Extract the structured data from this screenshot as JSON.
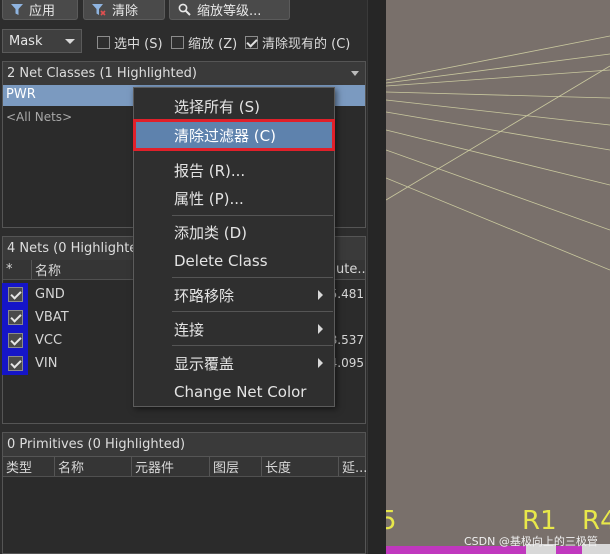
{
  "toolbar": {
    "apply_label": "应用",
    "clear_label": "清除",
    "zoom_level_label": "缩放等级..."
  },
  "filter": {
    "mode_value": "Mask",
    "select_label": "选中 (S)",
    "zoom_label": "缩放 (Z)",
    "clear_existing_label": "清除现有的 (C)",
    "select_checked": false,
    "zoom_checked": false,
    "clear_existing_checked": true
  },
  "net_classes": {
    "header": "2 Net Classes (1 Highlighted)",
    "items": [
      "PWR",
      "<All Nets>"
    ]
  },
  "nets": {
    "header": "4 Nets (0 Highlighted",
    "col_star": "*",
    "col_name": "名称",
    "col_route": "ute...",
    "rows": [
      {
        "name": "GND",
        "value": "5.481"
      },
      {
        "name": "VBAT",
        "value": ""
      },
      {
        "name": "VCC",
        "value": "8.537"
      },
      {
        "name": "VIN",
        "value": "4.095"
      }
    ]
  },
  "primitives": {
    "header": "0 Primitives (0 Highlighted)",
    "columns": [
      "类型",
      "名称",
      "元器件",
      "图层",
      "长度",
      "延..."
    ]
  },
  "context_menu": {
    "items": [
      {
        "label": "选择所有 (S)"
      },
      {
        "label": "清除过滤器 (C)"
      },
      {
        "label": "报告 (R)..."
      },
      {
        "label": "属性 (P)..."
      },
      {
        "label": "添加类 (D)"
      },
      {
        "label": "Delete Class"
      },
      {
        "label": "环路移除"
      },
      {
        "label": "连接"
      },
      {
        "label": "显示覆盖"
      },
      {
        "label": "Change Net Color"
      }
    ]
  },
  "pcb": {
    "labels": [
      "5",
      "R1",
      "R4"
    ],
    "watermark": "CSDN @基极向上的三极管"
  },
  "colors": {
    "highlight_row": "#7b9ac0",
    "menu_hover": "#5e82ad",
    "callout_red": "#e0202a",
    "net_color": "#1515c8",
    "pcb_background": "#79706b",
    "pcb_silk": "#e8e84a",
    "pcb_ratsnest": "#d8d8a8"
  }
}
